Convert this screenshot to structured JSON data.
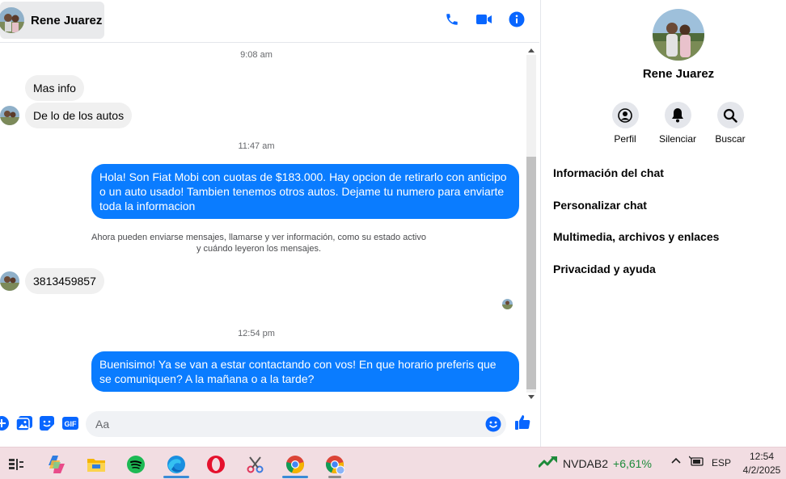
{
  "contact": {
    "name": "Rene Juarez"
  },
  "messages": {
    "ts1": "9:08 am",
    "in1": "Mas info",
    "in2": "De lo de los autos",
    "ts2": "11:47 am",
    "out1": "Hola! Son Fiat Mobi con cuotas de $183.000. Hay opcion de retirarlo con anticipo o un auto usado! Tambien tenemos otros autos. Dejame tu numero para enviarte toda la informacion",
    "notice_line1": "Ahora pueden enviarse mensajes, llamarse y ver información, como su estado activo",
    "notice_line2": "y cuándo leyeron los mensajes.",
    "in3": "3813459857",
    "ts3": "12:54 pm",
    "out2": "Buenisimo! Ya se van a estar contactando con vos! En que horario preferis que se comuniquen? A la mañana o a la tarde?"
  },
  "composer": {
    "placeholder": "Aa",
    "gif_label": "GIF"
  },
  "info_panel": {
    "name": "Rene Juarez",
    "actions": [
      {
        "label": "Perfil",
        "icon": "profile-icon"
      },
      {
        "label": "Silenciar",
        "icon": "bell-icon"
      },
      {
        "label": "Buscar",
        "icon": "search-icon"
      }
    ],
    "menu": [
      "Información del chat",
      "Personalizar chat",
      "Multimedia, archivos y enlaces",
      "Privacidad y ayuda"
    ]
  },
  "taskbar": {
    "apps": [
      "task-view",
      "copilot",
      "file-explorer",
      "spotify",
      "edge",
      "opera",
      "snipping-tool",
      "chrome",
      "chrome-profile"
    ],
    "stock_ticker": "NVDAB2",
    "stock_change": "+6,61%",
    "language": "ESP",
    "time": "12:54",
    "date": "4/2/2025"
  },
  "colors": {
    "accent": "#0a7cff",
    "header_icons": "#0866ff",
    "stock_up": "#1d8a3a"
  }
}
